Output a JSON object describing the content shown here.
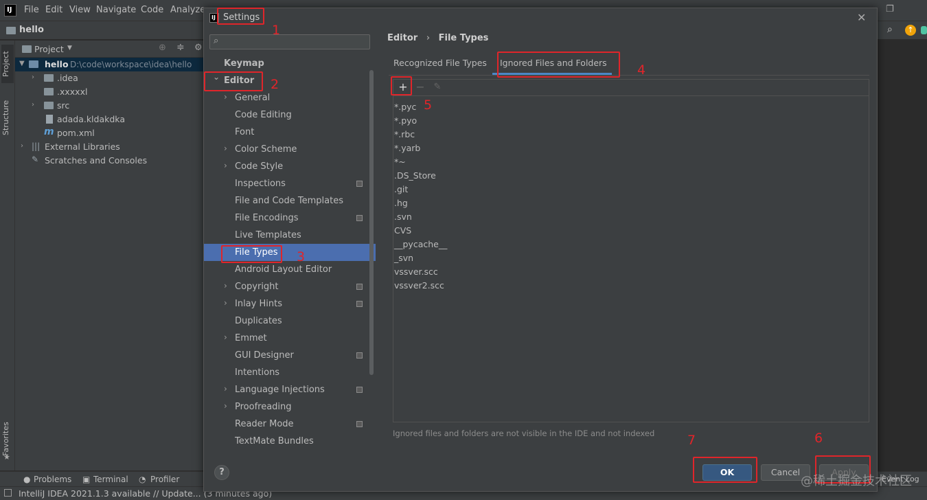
{
  "ide": {
    "logo": "IJ",
    "menu": [
      "File",
      "Edit",
      "View",
      "Navigate",
      "Code",
      "Analyze"
    ],
    "project_name": "hello",
    "project_tool_title": "Project",
    "left_tabs": [
      "Project",
      "Structure",
      "Favorites"
    ],
    "tree": [
      {
        "name": "hello",
        "path": "D:\\code\\workspace\\idea\\hello",
        "level": 0,
        "type": "module",
        "expanded": true
      },
      {
        "name": ".idea",
        "level": 1,
        "type": "folder",
        "expanded": false
      },
      {
        "name": ".xxxxxl",
        "level": 1,
        "type": "folder",
        "expanded": false
      },
      {
        "name": "src",
        "level": 1,
        "type": "folder",
        "expanded": false
      },
      {
        "name": "adada.kldakdka",
        "level": 1,
        "type": "file"
      },
      {
        "name": "pom.xml",
        "level": 1,
        "type": "maven"
      },
      {
        "name": "External Libraries",
        "level": 0,
        "type": "library",
        "expanded": false
      },
      {
        "name": "Scratches and Consoles",
        "level": 0,
        "type": "scratch"
      }
    ],
    "bottom_tabs": [
      "Problems",
      "Terminal",
      "Profiler"
    ],
    "event_log": "Event Log",
    "status": "IntelliJ IDEA 2021.1.3 available // Update... (3 minutes ago)"
  },
  "dialog": {
    "title": "Settings",
    "search_placeholder": "",
    "tree": [
      {
        "label": "Keymap",
        "level": 0,
        "bold": true
      },
      {
        "label": "Editor",
        "level": 0,
        "bold": true,
        "chevron": "down"
      },
      {
        "label": "General",
        "level": 1,
        "chevron": "right"
      },
      {
        "label": "Code Editing",
        "level": 1
      },
      {
        "label": "Font",
        "level": 1
      },
      {
        "label": "Color Scheme",
        "level": 1,
        "chevron": "right"
      },
      {
        "label": "Code Style",
        "level": 1,
        "chevron": "right"
      },
      {
        "label": "Inspections",
        "level": 1,
        "project": true
      },
      {
        "label": "File and Code Templates",
        "level": 1
      },
      {
        "label": "File Encodings",
        "level": 1,
        "project": true
      },
      {
        "label": "Live Templates",
        "level": 1
      },
      {
        "label": "File Types",
        "level": 1,
        "selected": true
      },
      {
        "label": "Android Layout Editor",
        "level": 1
      },
      {
        "label": "Copyright",
        "level": 1,
        "chevron": "right",
        "project": true
      },
      {
        "label": "Inlay Hints",
        "level": 1,
        "chevron": "right",
        "project": true
      },
      {
        "label": "Duplicates",
        "level": 1
      },
      {
        "label": "Emmet",
        "level": 1,
        "chevron": "right"
      },
      {
        "label": "GUI Designer",
        "level": 1,
        "project": true
      },
      {
        "label": "Intentions",
        "level": 1
      },
      {
        "label": "Language Injections",
        "level": 1,
        "chevron": "right",
        "project": true
      },
      {
        "label": "Proofreading",
        "level": 1,
        "chevron": "right"
      },
      {
        "label": "Reader Mode",
        "level": 1,
        "project": true
      },
      {
        "label": "TextMate Bundles",
        "level": 1
      }
    ],
    "breadcrumb": [
      "Editor",
      "File Types"
    ],
    "breadcrumb_sep": "›",
    "tabs": [
      {
        "label": "Recognized File Types",
        "active": false
      },
      {
        "label": "Ignored Files and Folders",
        "active": true
      }
    ],
    "toolbar": {
      "add": "+",
      "remove": "−",
      "edit": "✎"
    },
    "ignored": [
      "*.pyc",
      "*.pyo",
      "*.rbc",
      "*.yarb",
      "*~",
      ".DS_Store",
      ".git",
      ".hg",
      ".svn",
      "CVS",
      "__pycache__",
      "_svn",
      "vssver.scc",
      "vssver2.scc"
    ],
    "hint": "Ignored files and folders are not visible in the IDE and not indexed",
    "help": "?",
    "buttons": {
      "ok": "OK",
      "cancel": "Cancel",
      "apply": "Apply"
    },
    "close": "✕"
  },
  "annotations": [
    "1",
    "2",
    "3",
    "4",
    "5",
    "6",
    "7"
  ],
  "watermark": "@稀土掘金技术社区",
  "colors": {
    "accent": "#4b6eaf",
    "annotation": "#e0252a",
    "ok_button": "#365880"
  }
}
